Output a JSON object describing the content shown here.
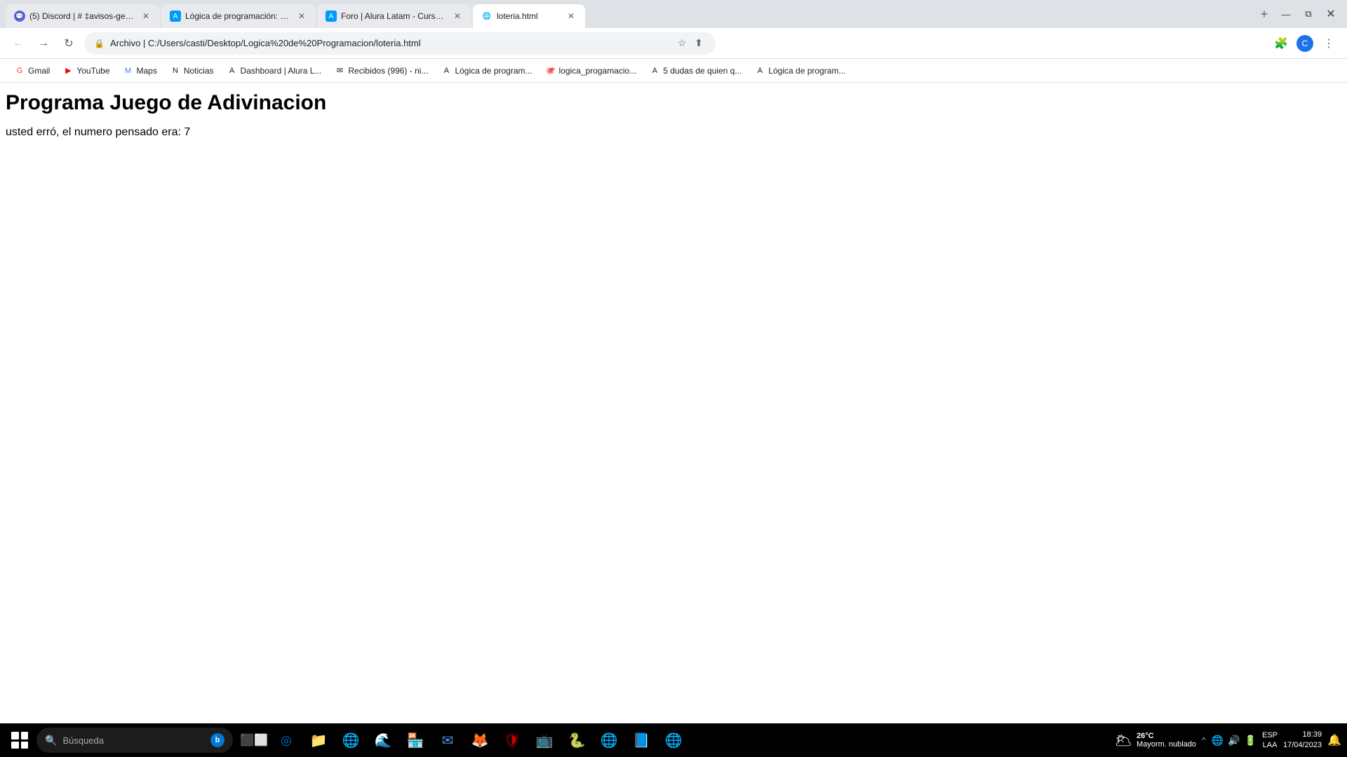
{
  "browser": {
    "tabs": [
      {
        "id": "discord",
        "title": "(5) Discord | # ‡avisos-genera...",
        "favicon": "💬",
        "active": false,
        "closable": true
      },
      {
        "id": "alura1",
        "title": "Lógica de programación: Conce...",
        "favicon": "A",
        "active": false,
        "closable": true
      },
      {
        "id": "alura2",
        "title": "Foro | Alura Latam - Cursos onli...",
        "favicon": "A",
        "active": false,
        "closable": true
      },
      {
        "id": "loteria",
        "title": "loteria.html",
        "favicon": "🌐",
        "active": true,
        "closable": true
      }
    ],
    "address_bar": {
      "url": "C:/Users/casti/Desktop/Logica%20de%20Programacion/loteria.html",
      "display": "Archivo  |  C:/Users/casti/Desktop/Logica%20de%20Programacion/loteria.html"
    },
    "bookmarks": [
      {
        "id": "gmail",
        "label": "Gmail",
        "favicon": "G"
      },
      {
        "id": "youtube",
        "label": "YouTube",
        "favicon": "▶"
      },
      {
        "id": "maps",
        "label": "Maps",
        "favicon": "M"
      },
      {
        "id": "noticias",
        "label": "Noticias",
        "favicon": "N"
      },
      {
        "id": "dashboard",
        "label": "Dashboard | Alura L...",
        "favicon": "A"
      },
      {
        "id": "recibidos",
        "label": "Recibidos (996) - ni...",
        "favicon": "✉"
      },
      {
        "id": "logica1",
        "label": "Lógica de program...",
        "favicon": "A"
      },
      {
        "id": "github",
        "label": "logica_progamacio...",
        "favicon": "🐙"
      },
      {
        "id": "5dudas",
        "label": "5 dudas de quien q...",
        "favicon": "A"
      },
      {
        "id": "logica2",
        "label": "Lógica de program...",
        "favicon": "A"
      }
    ]
  },
  "page": {
    "title": "Programa Juego de Adivinacion",
    "body_text": "usted erró, el numero pensado era:  7"
  },
  "taskbar": {
    "search_placeholder": "Búsqueda",
    "weather": {
      "temp": "26°C",
      "description": "Mayorm. nublado",
      "icon": "🌥"
    },
    "language": {
      "line1": "ESP",
      "line2": "LAA"
    },
    "clock": {
      "time": "18:39",
      "date": "17/04/2023"
    },
    "apps": [
      {
        "id": "task-view",
        "icon": "⬜",
        "label": "Task View"
      },
      {
        "id": "cortana",
        "icon": "🌀",
        "label": "Cortana"
      },
      {
        "id": "explorer",
        "icon": "📁",
        "label": "File Explorer"
      },
      {
        "id": "chrome",
        "icon": "🌐",
        "label": "Chrome"
      },
      {
        "id": "edge",
        "icon": "🌊",
        "label": "Edge"
      },
      {
        "id": "store",
        "icon": "🏪",
        "label": "Store"
      },
      {
        "id": "notepad",
        "icon": "📝",
        "label": "Notepad"
      },
      {
        "id": "antivirus",
        "icon": "🦊",
        "label": "Antivirus"
      },
      {
        "id": "shield",
        "icon": "🛡",
        "label": "Security"
      },
      {
        "id": "mail2",
        "icon": "📬",
        "label": "Mail"
      },
      {
        "id": "python",
        "icon": "🐍",
        "label": "Python"
      },
      {
        "id": "chrome2",
        "icon": "🌐",
        "label": "Chrome 2"
      },
      {
        "id": "vscode",
        "icon": "📘",
        "label": "VS Code"
      },
      {
        "id": "browser2",
        "icon": "🌐",
        "label": "Browser"
      }
    ]
  }
}
